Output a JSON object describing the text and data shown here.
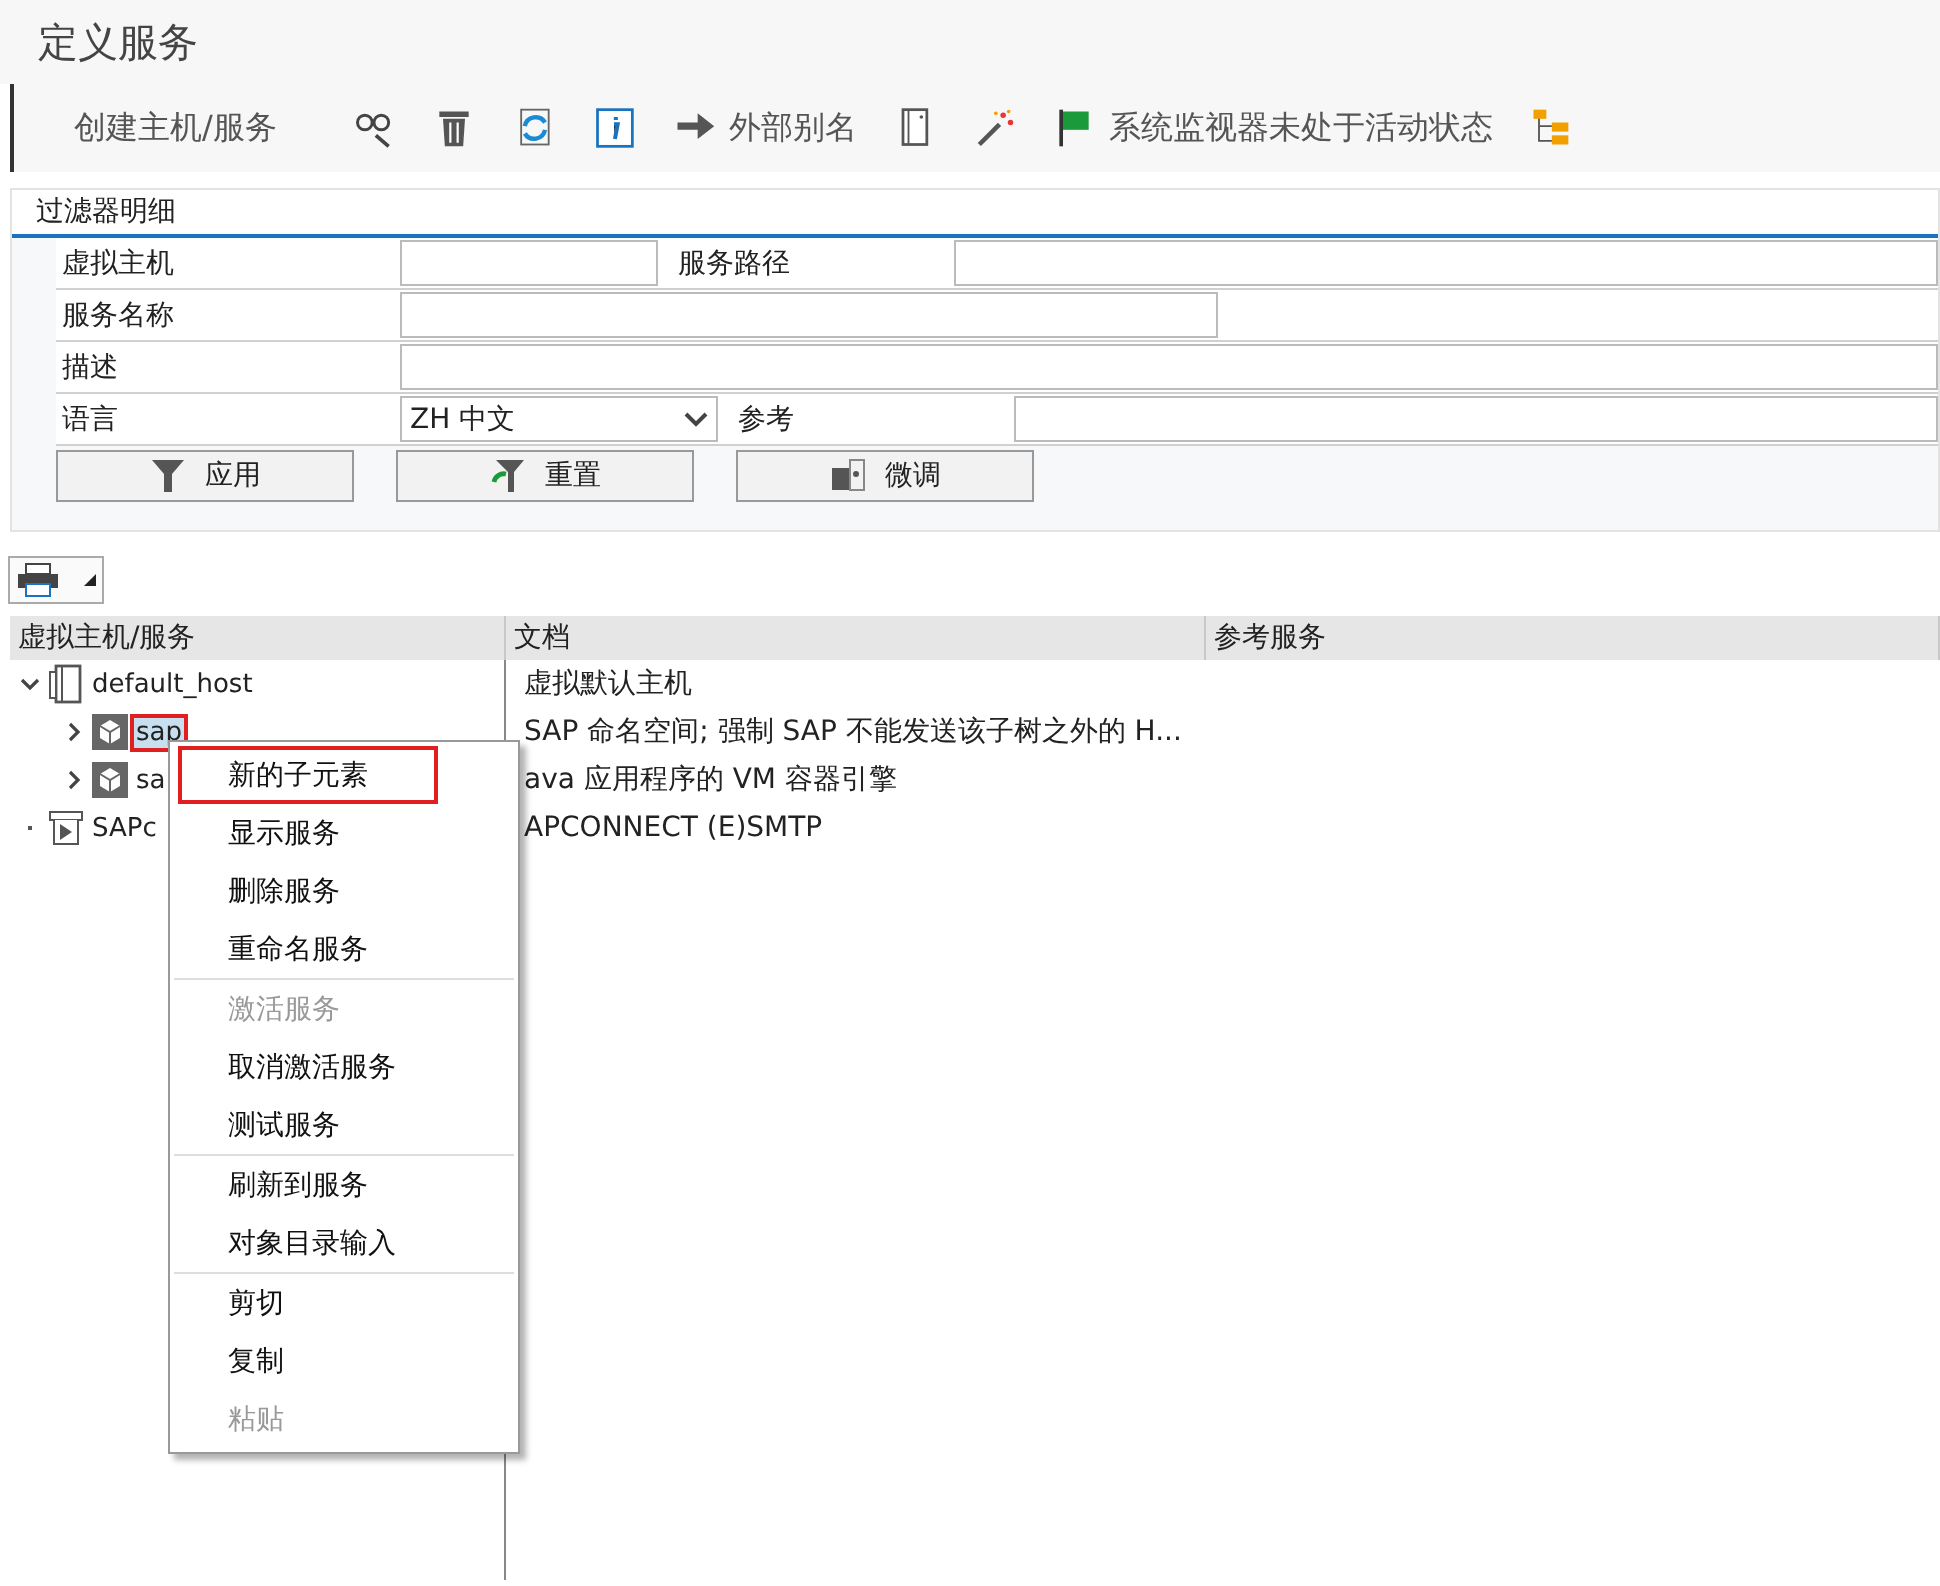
{
  "window": {
    "title": "定义服务"
  },
  "toolbar": [
    {
      "kind": "text",
      "label": "创建主机/服务"
    },
    {
      "kind": "icon"
    },
    {
      "kind": "icon"
    },
    {
      "kind": "icon"
    },
    {
      "kind": "icon"
    },
    {
      "kind": "icon_text",
      "label": "外部别名"
    },
    {
      "kind": "icon"
    },
    {
      "kind": "icon"
    },
    {
      "kind": "icon_text",
      "label": "系统监视器未处于活动状态"
    },
    {
      "kind": "icon"
    }
  ],
  "filter": {
    "title": "过滤器明细",
    "rows": [
      [
        {
          "label": "虚拟主机",
          "kind": "input"
        },
        {
          "label": "服务路径",
          "kind": "input"
        }
      ],
      [
        {
          "label": "服务名称",
          "kind": "input"
        }
      ],
      [
        {
          "label": "描述",
          "kind": "input"
        }
      ],
      [
        {
          "label": "语言",
          "kind": "dropdown",
          "value": "ZH 中文"
        },
        {
          "label": "参考",
          "kind": "input"
        }
      ]
    ],
    "buttons": [
      "应用",
      "重置",
      "微调"
    ]
  },
  "table": {
    "columns": [
      "虚拟主机/服务",
      "文档",
      "参考服务"
    ],
    "tree": [
      {
        "name": "default_host",
        "kind": "host",
        "expanded": true,
        "selected": false,
        "doc": "虚拟默认主机",
        "children": [
          {
            "name": "sap",
            "kind": "service",
            "expanded": false,
            "selected": true,
            "highlighted": true,
            "doc": "SAP 命名空间; 强制 SAP 不能发送该子树之外的 H..."
          },
          {
            "name": "sa",
            "kind": "service",
            "expanded": false,
            "selected": false,
            "doc": "ava 应用程序的 VM 容器引擎"
          }
        ]
      },
      {
        "name": "SAPc",
        "kind": "external",
        "selected": false,
        "doc": "APCONNECT (E)SMTP"
      }
    ]
  },
  "context_menu": {
    "groups": [
      [
        {
          "label": "新的子元素",
          "disabled": false,
          "highlighted": true
        },
        {
          "label": "显示服务",
          "disabled": false,
          "highlighted": false
        },
        {
          "label": "删除服务",
          "disabled": false,
          "highlighted": false
        },
        {
          "label": "重命名服务",
          "disabled": false,
          "highlighted": false
        }
      ],
      [
        {
          "label": "激活服务",
          "disabled": true,
          "highlighted": false
        },
        {
          "label": "取消激活服务",
          "disabled": false,
          "highlighted": false
        },
        {
          "label": "测试服务",
          "disabled": false,
          "highlighted": false
        }
      ],
      [
        {
          "label": "刷新到服务",
          "disabled": false,
          "highlighted": false
        },
        {
          "label": "对象目录输入",
          "disabled": false,
          "highlighted": false
        }
      ],
      [
        {
          "label": "剪切",
          "disabled": false,
          "highlighted": false
        },
        {
          "label": "复制",
          "disabled": false,
          "highlighted": false
        },
        {
          "label": "粘贴",
          "disabled": true,
          "highlighted": false
        }
      ]
    ]
  }
}
